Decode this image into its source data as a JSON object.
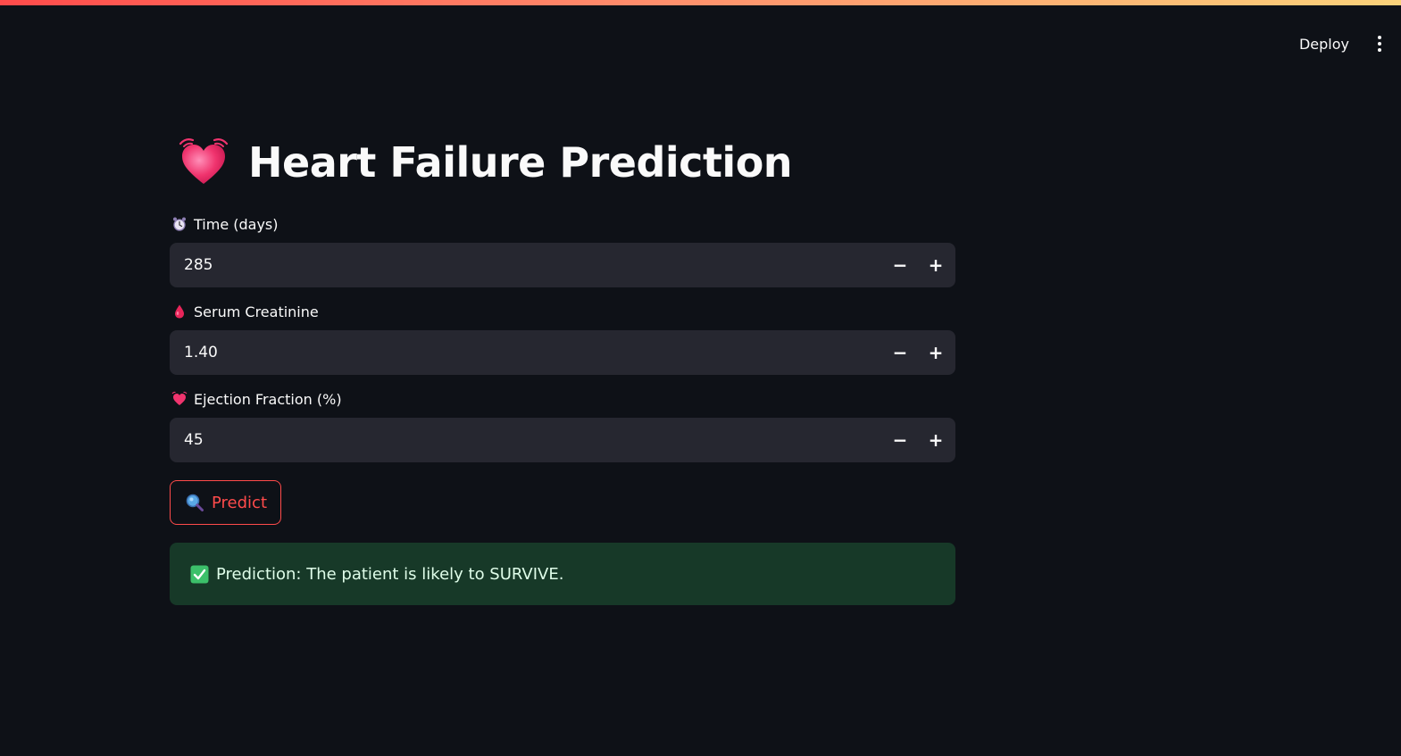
{
  "header": {
    "deploy_label": "Deploy",
    "menu_icon": "kebab-menu-icon"
  },
  "page": {
    "title": "Heart Failure Prediction",
    "title_icon": "beating-heart-icon"
  },
  "fields": [
    {
      "label": "Time (days)",
      "value": "285",
      "icon": "alarm-clock-icon"
    },
    {
      "label": "Serum Creatinine",
      "value": "1.40",
      "icon": "drop-of-blood-icon"
    },
    {
      "label": "Ejection Fraction (%)",
      "value": "45",
      "icon": "beating-heart-icon"
    }
  ],
  "stepper": {
    "minus": "−",
    "plus": "+"
  },
  "predict_button": {
    "label": "Predict",
    "icon": "magnifying-glass-icon"
  },
  "result": {
    "text": "Prediction: The patient is likely to SURVIVE.",
    "icon": "check-mark-button-icon"
  },
  "colors": {
    "background": "#0e1117",
    "input_bg": "#262730",
    "accent": "#ff4b4b",
    "success_bg": "#173928",
    "success_text": "#dffde9"
  }
}
